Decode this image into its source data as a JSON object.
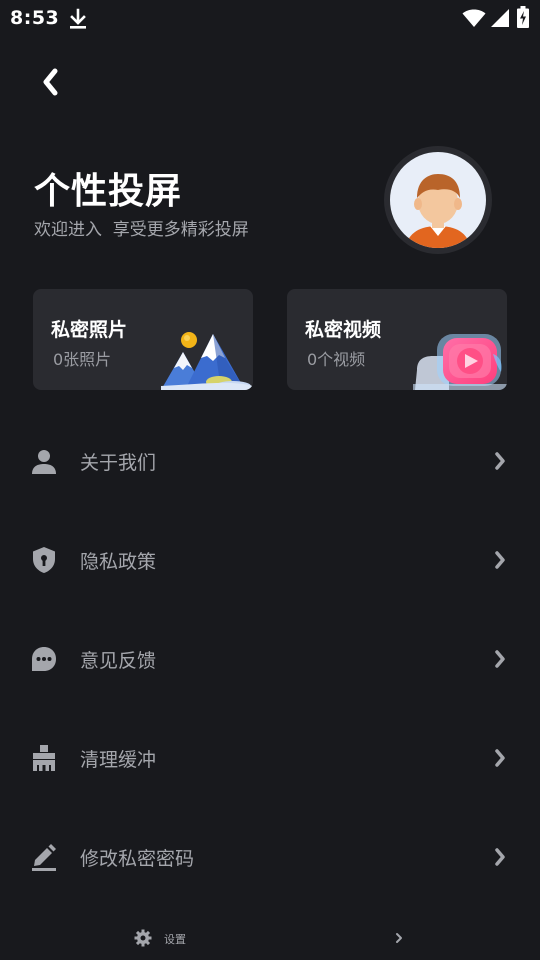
{
  "status_bar": {
    "time": "8:53",
    "icons": [
      "download-icon",
      "wifi-icon",
      "signal-icon",
      "battery-charging-icon"
    ]
  },
  "header": {
    "back_icon": "chevron-left-icon",
    "title": "个性投屏",
    "subtitle": "欢迎进入  享受更多精彩投屏",
    "avatar_icon": "user-avatar-icon"
  },
  "cards": [
    {
      "title": "私密照片",
      "count": "0张照片",
      "icon": "mountain-illustration-icon"
    },
    {
      "title": "私密视频",
      "count": "0个视频",
      "icon": "video-play-illustration-icon"
    }
  ],
  "menu": [
    {
      "label": "关于我们",
      "icon": "person-icon"
    },
    {
      "label": "隐私政策",
      "icon": "shield-icon"
    },
    {
      "label": "意见反馈",
      "icon": "chat-bubble-icon"
    },
    {
      "label": "清理缓冲",
      "icon": "broom-icon"
    },
    {
      "label": "修改私密密码",
      "icon": "edit-pencil-icon"
    }
  ],
  "settings": {
    "label": "设置",
    "icon": "gear-icon"
  },
  "colors": {
    "background": "#18191d",
    "card_background": "#2a2b30",
    "primary_text": "#ffffff",
    "secondary_text": "#a4a6ac"
  }
}
